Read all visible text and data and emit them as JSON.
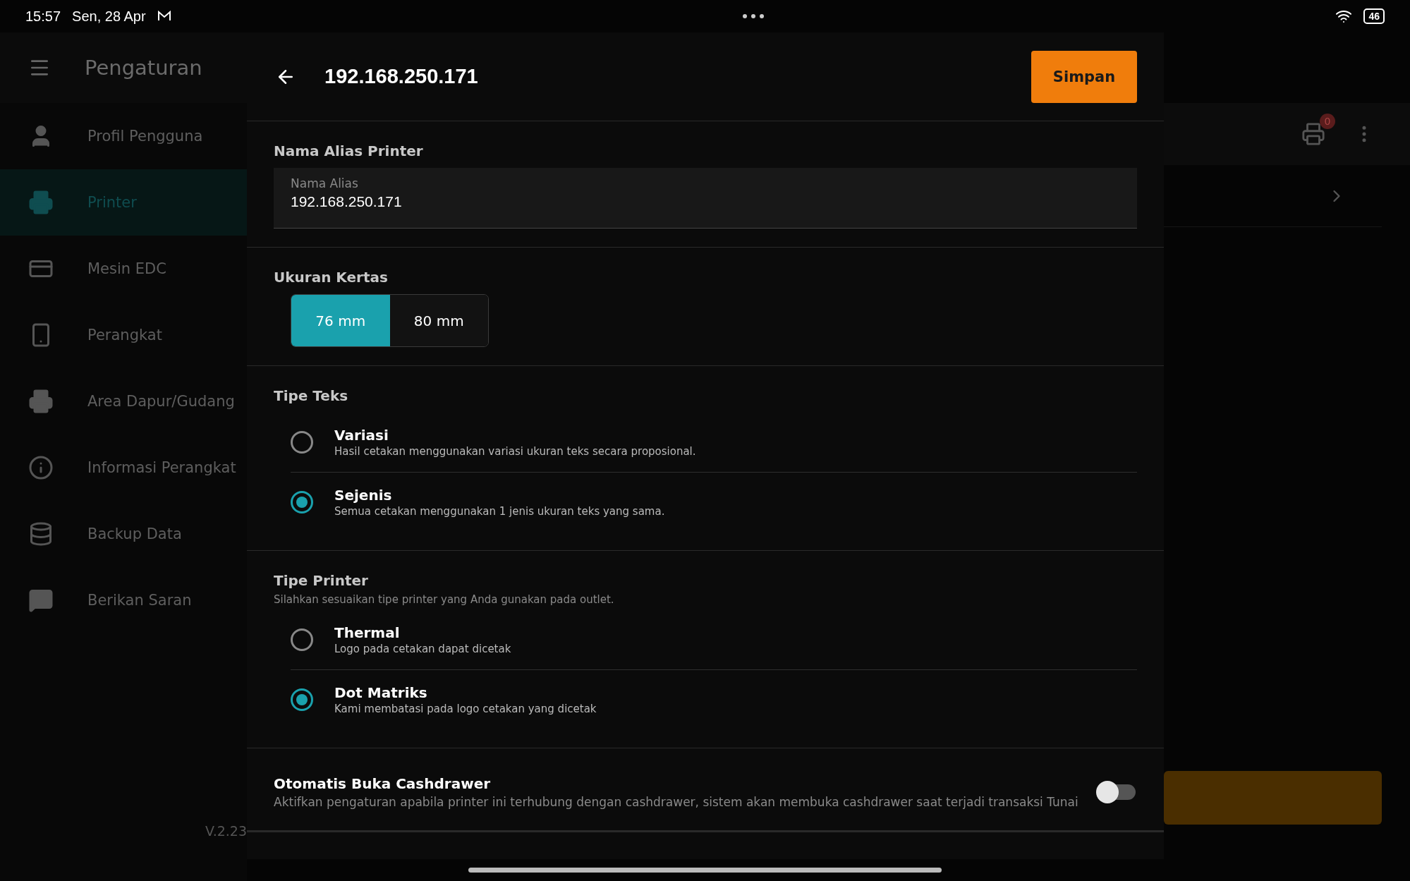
{
  "status_bar": {
    "time": "15:57",
    "date": "Sen, 28 Apr",
    "battery": "46"
  },
  "sidebar": {
    "title": "Pengaturan",
    "items": [
      {
        "label": "Profil Pengguna",
        "selected": false
      },
      {
        "label": "Printer",
        "selected": true
      },
      {
        "label": "Mesin EDC",
        "selected": false
      },
      {
        "label": "Perangkat",
        "selected": false
      },
      {
        "label": "Area Dapur/Gudang",
        "selected": false
      },
      {
        "label": "Informasi Perangkat",
        "selected": false
      },
      {
        "label": "Backup Data",
        "selected": false
      },
      {
        "label": "Berikan Saran",
        "selected": false
      }
    ],
    "version": "V.2.23"
  },
  "main": {
    "printer_badge": "0"
  },
  "dialog": {
    "title": "192.168.250.171",
    "save_button": "Simpan",
    "alias": {
      "heading": "Nama Alias Printer",
      "field_label": "Nama Alias",
      "value": "192.168.250.171"
    },
    "paper_size": {
      "heading": "Ukuran Kertas",
      "options": [
        {
          "label": "76 mm",
          "selected": true
        },
        {
          "label": "80 mm",
          "selected": false
        }
      ]
    },
    "text_type": {
      "heading": "Tipe Teks",
      "options": [
        {
          "title": "Variasi",
          "description": "Hasil cetakan menggunakan variasi ukuran teks secara proposional.",
          "selected": false
        },
        {
          "title": "Sejenis",
          "description": "Semua cetakan menggunakan 1 jenis ukuran teks yang sama.",
          "selected": true
        }
      ]
    },
    "printer_type": {
      "heading": "Tipe Printer",
      "subtitle": "Silahkan sesuaikan tipe printer yang Anda gunakan pada outlet.",
      "options": [
        {
          "title": "Thermal",
          "description": "Logo pada cetakan dapat dicetak",
          "selected": false
        },
        {
          "title": "Dot Matriks",
          "description": "Kami membatasi pada logo cetakan yang dicetak",
          "selected": true
        }
      ]
    },
    "cashdrawer": {
      "title": "Otomatis Buka Cashdrawer",
      "description": "Aktifkan pengaturan apabila printer ini terhubung dengan cashdrawer, sistem akan membuka cashdrawer saat terjadi transaksi Tunai",
      "on": false
    }
  }
}
